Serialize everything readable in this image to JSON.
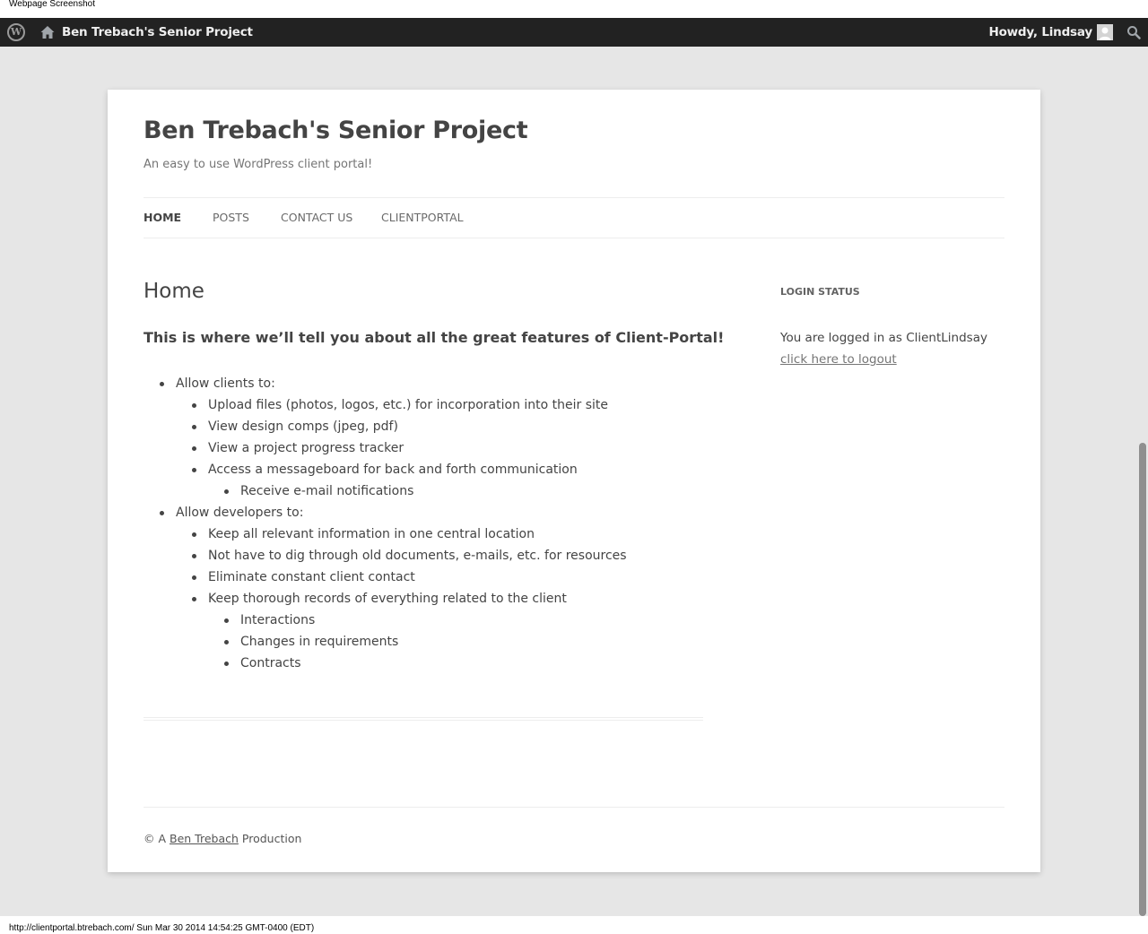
{
  "capture_label": "Webpage Screenshot",
  "admin_bar": {
    "wp_logo_icon": "wordpress-logo-icon",
    "home_icon": "home-icon",
    "site_name": "Ben Trebach's Senior Project",
    "howdy": "Howdy, Lindsay",
    "avatar_icon": "avatar-icon",
    "search_icon": "search-icon"
  },
  "site": {
    "title": "Ben Trebach's Senior Project",
    "description": "An easy to use WordPress client portal!"
  },
  "nav": {
    "items": [
      {
        "label": "HOME"
      },
      {
        "label": "POSTS"
      },
      {
        "label": "CONTACT US"
      },
      {
        "label": "CLIENTPORTAL"
      }
    ]
  },
  "entry": {
    "title": "Home",
    "lead": "This is where we’ll tell you about all the great features of Client-Portal!",
    "list": {
      "clients": {
        "label": "Allow clients to:",
        "items": [
          "Upload files (photos, logos, etc.) for incorporation into their site",
          "View design comps (jpeg, pdf)",
          "View a project progress tracker",
          "Access a messageboard for back and forth communication"
        ],
        "sub": [
          "Receive e-mail notifications"
        ]
      },
      "developers": {
        "label": "Allow developers to:",
        "items": [
          "Keep all relevant information in one central location",
          "Not have to dig through old documents, e-mails, etc. for resources",
          "Eliminate constant client contact",
          "Keep thorough records of everything related to the client"
        ],
        "sub": [
          "Interactions",
          "Changes in requirements",
          "Contracts"
        ]
      }
    }
  },
  "widget": {
    "title": "LOGIN STATUS",
    "text": "You are logged in as ClientLindsay",
    "logout_link": "click here to logout"
  },
  "footer": {
    "prefix": "© A",
    "link": "Ben Trebach",
    "suffix": "Production"
  },
  "status_url": "http://clientportal.btrebach.com/ Sun Mar 30 2014 14:54:25 GMT-0400 (EDT)",
  "colors": {
    "admin_bar": "#222222",
    "page_background": "#e6e6e6",
    "site_background": "#ffffff",
    "text": "#444444"
  }
}
